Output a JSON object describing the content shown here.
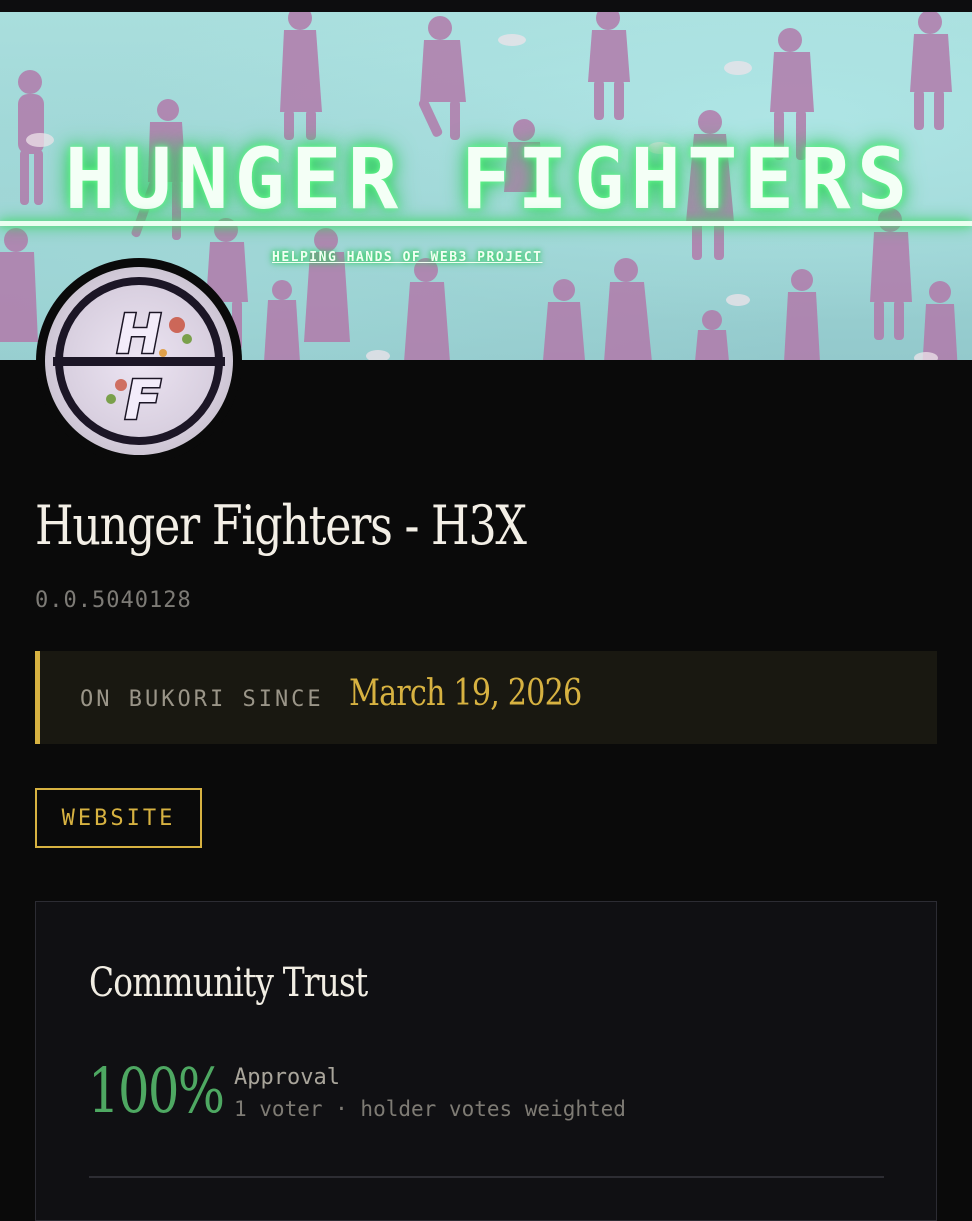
{
  "banner": {
    "title": "HUNGER FIGHTERS",
    "subtitle": "HELPING HANDS OF WEB3 PROJECT"
  },
  "avatar": {
    "monogram_top": "H",
    "monogram_bottom": "F"
  },
  "project": {
    "name": "Hunger Fighters - H3X",
    "id": "0.0.5040128"
  },
  "since": {
    "label": "ON BUKORI SINCE",
    "date": "March 19, 2026"
  },
  "website_button": {
    "label": "WEBSITE"
  },
  "community_trust": {
    "title": "Community Trust",
    "approval_percent": "100%",
    "approval_label": "Approval",
    "meta": "1 voter · holder votes weighted"
  },
  "colors": {
    "background": "#0a0a0a",
    "accent_gold": "#d7b241",
    "approval_green": "#4ea862",
    "banner_glow": "#37d866",
    "banner_sky": "#a9dedd",
    "silhouette": "#b27aab"
  },
  "icons": [
    "hunger-fighters-logo"
  ]
}
